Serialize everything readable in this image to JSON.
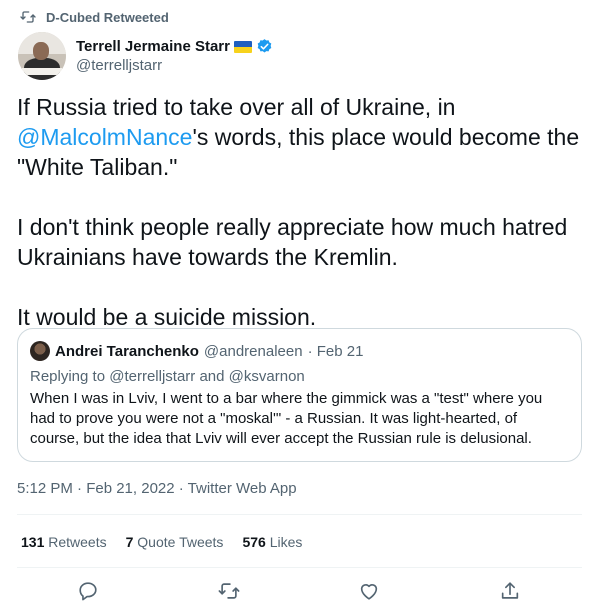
{
  "retweet": {
    "label": "D-Cubed Retweeted",
    "icon": "retweet-icon"
  },
  "author": {
    "name": "Terrell Jermaine Starr",
    "flag": "ukraine-flag-emoji",
    "verified_icon": "verified-badge-icon",
    "handle": "@terrelljstarr"
  },
  "tweet": {
    "p1_a": "If Russia tried to take over all of Ukraine, in ",
    "p1_mention": "@MalcolmNance",
    "p1_b": "'s words, this place would become the \"White Taliban.\"",
    "p2": "I don't think people really appreciate how much hatred Ukrainians have towards the Kremlin.",
    "p3": "It would be a suicide mission."
  },
  "quote": {
    "name": "Andrei Taranchenko",
    "handle": "@andrenaleen",
    "date": "· Feb 21",
    "replying_prefix": "Replying to ",
    "reply_to_1": "@terrelljstarr",
    "reply_and": " and ",
    "reply_to_2": "@ksvarnon",
    "text": "When I was in Lviv, I went to a bar where the gimmick was a \"test\" where you had to prove you were not a \"moskal'\" - a Russian. It was light-hearted, of course, but the idea that Lviv will ever accept the Russian rule is delusional."
  },
  "timestamp": "5:12 PM · Feb 21, 2022 · Twitter Web App",
  "stats": {
    "retweets_count": "131",
    "retweets_label": "Retweets",
    "quotes_count": "7",
    "quotes_label": "Quote Tweets",
    "likes_count": "576",
    "likes_label": "Likes"
  },
  "actions": [
    "reply-icon",
    "retweet-icon",
    "like-icon",
    "share-icon"
  ],
  "colors": {
    "accent": "#1d9bf0",
    "muted": "#536471",
    "text": "#0f1419",
    "border": "#cfd9de"
  }
}
